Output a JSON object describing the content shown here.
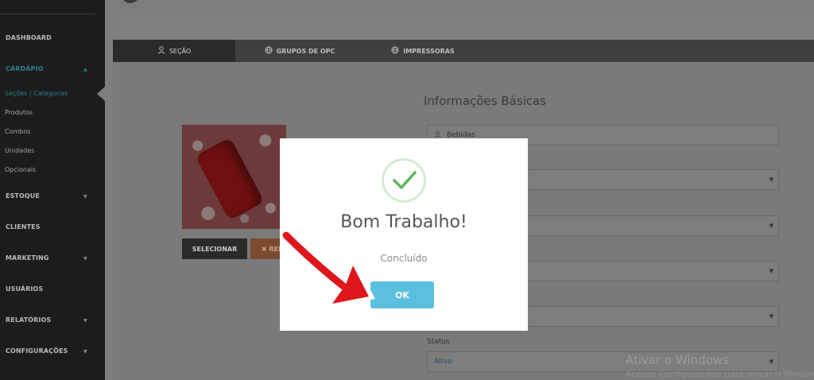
{
  "sidebar": {
    "items": [
      {
        "label": "DASHBOARD"
      },
      {
        "label": "CARDÁPIO"
      },
      {
        "label": "ESTOQUE"
      },
      {
        "label": "CLIENTES"
      },
      {
        "label": "MARKETING"
      },
      {
        "label": "USUÁRIOS"
      },
      {
        "label": "RELATÓRIOS"
      },
      {
        "label": "CONFIGURAÇÕES"
      }
    ],
    "submenu": [
      {
        "label": "Seções | Categorias"
      },
      {
        "label": "Produtos"
      },
      {
        "label": "Combos"
      },
      {
        "label": "Unidades"
      },
      {
        "label": "Opcionais"
      }
    ]
  },
  "tabs": [
    {
      "label": "SEÇÃO",
      "icon": "user-icon"
    },
    {
      "label": "GRUPOS DE OPC",
      "icon": "globe-icon"
    },
    {
      "label": "IMPRESSORAS",
      "icon": "globe-icon"
    }
  ],
  "image_card": {
    "select_label": "SELECIONAR",
    "remove_label": "✖ REM"
  },
  "form": {
    "section_title": "Informações Básicas",
    "name_value": "Bebidas",
    "status_label": "Status",
    "status_value": "Ativo"
  },
  "modal": {
    "title": "Bom Trabalho!",
    "text": "Concluído",
    "ok_label": "OK",
    "accent": "#5bc0de",
    "success_color": "#5cb85c"
  },
  "watermark": {
    "line1": "Ativar o Windows",
    "line2": "Acesse Configurações para ativar o Windows."
  }
}
